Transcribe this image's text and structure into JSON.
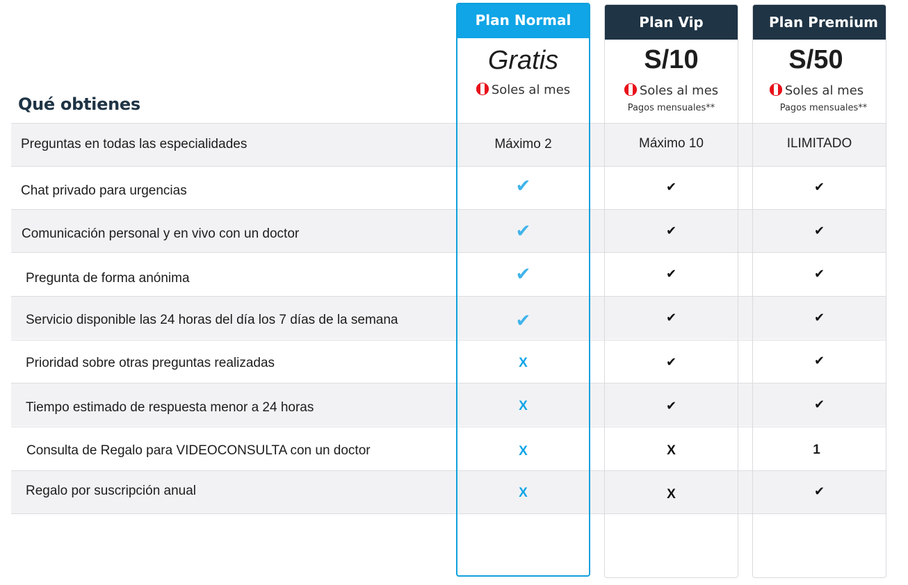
{
  "heading": "Qué obtienes",
  "plans": [
    {
      "name": "Plan Normal",
      "price": "Gratis",
      "period": "Soles al mes",
      "note": ""
    },
    {
      "name": "Plan Vip",
      "price": "S/10",
      "period": "Soles al mes",
      "note": "Pagos mensuales**"
    },
    {
      "name": "Plan Premium",
      "price": "S/50",
      "period": "Soles al mes",
      "note": "Pagos mensuales**"
    }
  ],
  "features": [
    {
      "label": "Preguntas en todas las especialidades",
      "normal": "Máximo 2",
      "vip": "Máximo 10",
      "premium": "ILIMITADO"
    },
    {
      "label": "Chat privado para urgencias",
      "normal": "✔",
      "vip": "✔",
      "premium": "✔"
    },
    {
      "label": "Comunicación personal y en vivo con un doctor",
      "normal": "✔",
      "vip": "✔",
      "premium": "✔"
    },
    {
      "label": "Pregunta de forma anónima",
      "normal": "✔",
      "vip": "✔",
      "premium": "✔"
    },
    {
      "label": "Servicio disponible las 24 horas del día los 7 días de la semana",
      "normal": "✔",
      "vip": "✔",
      "premium": "✔"
    },
    {
      "label": "Prioridad sobre otras preguntas realizadas",
      "normal": "X",
      "vip": "✔",
      "premium": "✔"
    },
    {
      "label": "Tiempo estimado de respuesta menor a 24 horas",
      "normal": "X",
      "vip": "✔",
      "premium": "✔"
    },
    {
      "label": "Consulta de Regalo para VIDEOCONSULTA con un doctor",
      "normal": "X",
      "vip": "X",
      "premium": "1"
    },
    {
      "label": "Regalo por suscripción anual",
      "normal": "X",
      "vip": "X",
      "premium": "✔"
    }
  ],
  "colors": {
    "normal_accent": "#0fa5e6",
    "dark_header": "#1f3445",
    "row_alt": "#f2f2f4"
  }
}
